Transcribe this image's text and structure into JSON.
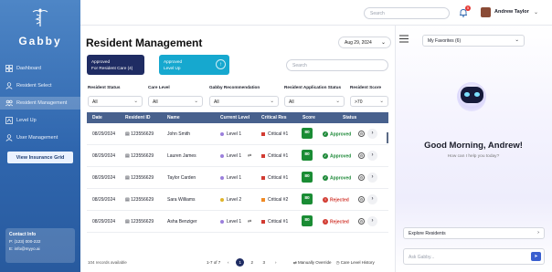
{
  "brand": {
    "name": "Gabby"
  },
  "sidebar": {
    "items": [
      {
        "label": "Dashboard",
        "icon": "dashboard-icon"
      },
      {
        "label": "Resident Select",
        "icon": "resident-icon"
      },
      {
        "label": "Resident Management",
        "icon": "people-icon",
        "active": true
      },
      {
        "label": "Level Up",
        "icon": "level-icon"
      },
      {
        "label": "User Management",
        "icon": "user-icon"
      }
    ],
    "insurance_button": "View Insurance Grid",
    "contact": {
      "title": "Contact Info",
      "phone": "P: (123) 000-222",
      "email": "E: info@myyo.ai"
    }
  },
  "topbar": {
    "search_placeholder": "Search",
    "notifications": "5",
    "user_name": "Andrew Taylor",
    "chevron": "⌄"
  },
  "main": {
    "title": "Resident Management",
    "date": "Aug 29, 2024",
    "cards": [
      {
        "line1": "Approved",
        "line2": "For Resident Care (4)"
      },
      {
        "line1": "Approved",
        "line2": "Level Up"
      }
    ],
    "search_placeholder": "Search",
    "filters": [
      {
        "label": "Resident Status",
        "value": "All"
      },
      {
        "label": "Care Level",
        "value": "All"
      },
      {
        "label": "Gabby Recommendation",
        "value": "All"
      },
      {
        "label": "Resident Application Status",
        "value": "All"
      },
      {
        "label": "Resident Score",
        "value": ">70"
      }
    ],
    "columns": [
      "Date",
      "Resident ID",
      "Name",
      "Current Level",
      "Critical Res",
      "Score",
      "Status"
    ],
    "rows": [
      {
        "date": "08/29/2024",
        "id": "123556629",
        "name": "John Smith",
        "level": "Level 1",
        "level_color": "#9b7fdc",
        "critical": "Critical #1",
        "critical_color": "#d23b32",
        "score": "80",
        "status": "Approved",
        "status_kind": "ok"
      },
      {
        "date": "08/29/2024",
        "id": "123556629",
        "name": "Lauren James",
        "level": "Level 1",
        "level_color": "#9b7fdc",
        "critical": "Critical #1",
        "critical_color": "#d23b32",
        "score": "80",
        "status": "Approved",
        "status_kind": "ok",
        "swap": true
      },
      {
        "date": "08/29/2024",
        "id": "123556629",
        "name": "Taylor Carden",
        "level": "Level 1",
        "level_color": "#9b7fdc",
        "critical": "Critical #1",
        "critical_color": "#d23b32",
        "score": "80",
        "status": "Approved",
        "status_kind": "ok"
      },
      {
        "date": "08/29/2024",
        "id": "123556629",
        "name": "Sara Williams",
        "level": "Level 2",
        "level_color": "#e0b42a",
        "critical": "Critical #2",
        "critical_color": "#f08a24",
        "score": "80",
        "status": "Rejected",
        "status_kind": "rej"
      },
      {
        "date": "08/29/2024",
        "id": "123556629",
        "name": "Asha Benziger",
        "level": "Level 1",
        "level_color": "#9b7fdc",
        "critical": "Critical #1",
        "critical_color": "#d23b32",
        "score": "80",
        "status": "Rejected",
        "status_kind": "rej",
        "swap": true
      }
    ],
    "records_text": "104 records available",
    "pager": {
      "range": "1-7 of 7",
      "prev": "‹",
      "pages": [
        "1",
        "2",
        "3"
      ],
      "next": "›"
    },
    "footer_links": [
      "Manually Override",
      "Care Level History"
    ]
  },
  "assistant": {
    "favorites": "My Favorites (6)",
    "greeting": "Good Morning, Andrew!",
    "subtext": "How can I help you today?",
    "explore": "Explore Residents",
    "ask_placeholder": "Ask Gabby..."
  },
  "colors": {
    "sidebar": "#2f66ae",
    "header": "#48618d",
    "score": "#1a8c34",
    "approved": "#1f8a3a",
    "rejected": "#d23b32"
  }
}
